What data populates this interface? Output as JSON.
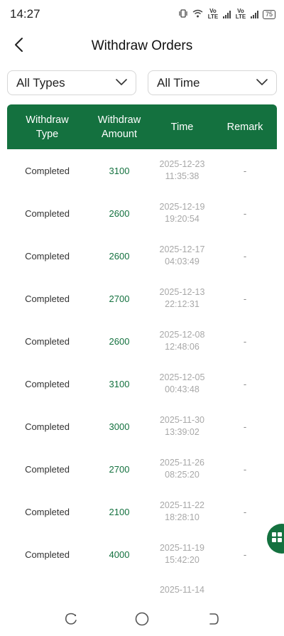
{
  "status_bar": {
    "time": "14:27",
    "network_1": "Vo LTE",
    "network_2": "Vo LTE",
    "battery": "75"
  },
  "header": {
    "title": "Withdraw Orders"
  },
  "filters": {
    "type_selected": "All Types",
    "time_selected": "All Time"
  },
  "table": {
    "columns": [
      "Withdraw Type",
      "Withdraw Amount",
      "Time",
      "Remark"
    ],
    "column_lines": [
      [
        "Withdraw",
        "Type"
      ],
      [
        "Withdraw",
        "Amount"
      ],
      [
        "Time"
      ],
      [
        "Remark"
      ]
    ],
    "rows": [
      {
        "type": "Completed",
        "amount": "3100",
        "date": "2025-12-23",
        "clock": "11:35:38",
        "remark": "-"
      },
      {
        "type": "Completed",
        "amount": "2600",
        "date": "2025-12-19",
        "clock": "19:20:54",
        "remark": "-"
      },
      {
        "type": "Completed",
        "amount": "2600",
        "date": "2025-12-17",
        "clock": "04:03:49",
        "remark": "-"
      },
      {
        "type": "Completed",
        "amount": "2700",
        "date": "2025-12-13",
        "clock": "22:12:31",
        "remark": "-"
      },
      {
        "type": "Completed",
        "amount": "2600",
        "date": "2025-12-08",
        "clock": "12:48:06",
        "remark": "-"
      },
      {
        "type": "Completed",
        "amount": "3100",
        "date": "2025-12-05",
        "clock": "00:43:48",
        "remark": "-"
      },
      {
        "type": "Completed",
        "amount": "3000",
        "date": "2025-11-30",
        "clock": "13:39:02",
        "remark": "-"
      },
      {
        "type": "Completed",
        "amount": "2700",
        "date": "2025-11-26",
        "clock": "08:25:20",
        "remark": "-"
      },
      {
        "type": "Completed",
        "amount": "2100",
        "date": "2025-11-22",
        "clock": "18:28:10",
        "remark": "-"
      },
      {
        "type": "Completed",
        "amount": "4000",
        "date": "2025-11-19",
        "clock": "15:42:20",
        "remark": "-"
      },
      {
        "type": "",
        "amount": "",
        "date": "2025-11-14",
        "clock": "",
        "remark": ""
      }
    ]
  },
  "icons": {
    "back": "chevron-left-icon",
    "dropdown": "chevron-down-icon",
    "fab": "grid-icon",
    "nav": [
      "recent-apps-icon",
      "home-icon",
      "back-nav-icon"
    ]
  },
  "colors": {
    "accent": "#14713f",
    "time_text": "#a8a8a8"
  }
}
